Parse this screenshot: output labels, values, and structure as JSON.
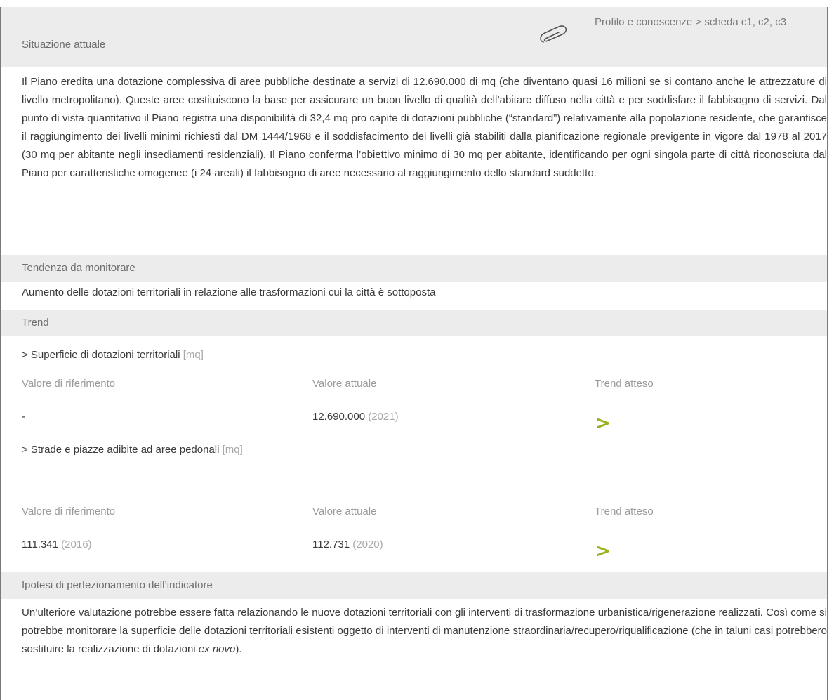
{
  "situazione": {
    "label": "Situazione attuale",
    "reference": "Profilo e conoscenze > scheda  c1, c2, c3",
    "paragraph": "Il Piano eredita una dotazione complessiva di aree pubbliche destinate a servizi di 12.690.000 di mq (che diventano quasi 16 milioni se si contano anche le attrezzature di livello metropolitano). Queste aree  costituiscono la base per assicurare un buon livello di qualità dell’abitare diffuso nella città e per soddisfare il fabbisogno di servizi. Dal punto di vista quantitativo il Piano registra una disponibilità di 32,4 mq pro capite di dotazioni pubbliche (“standard”) relativamente alla popolazione residente, che garantisce il raggiungimento dei livelli minimi richiesti dal DM 1444/1968 e il soddisfacimento dei livelli già stabiliti dalla pianificazione regionale previgente in vigore dal 1978 al 2017 (30 mq per abitante negli insediamenti residenziali). Il Piano conferma l’obiettivo minimo di 30 mq per abitante, identificando per ogni singola parte di città riconosciuta dal Piano per caratteristiche omogenee (i 24 areali) il fabbisogno di aree necessario al raggiungimento dello standard suddetto."
  },
  "tendenza": {
    "label": "Tendenza da monitorare",
    "text": "Aumento delle dotazioni territoriali in relazione alle trasformazioni cui la città è sottoposta"
  },
  "trend": {
    "label": "Trend",
    "indicators": [
      {
        "title": "> Superficie di dotazioni territoriali",
        "unit": "[mq]",
        "ref_label": "Valore di riferimento",
        "cur_label": "Valore attuale",
        "exp_label": "Trend atteso",
        "ref_value": "-",
        "ref_year": "",
        "cur_value": "12.690.000",
        "cur_year": "(2021)",
        "arrow": ">"
      },
      {
        "title": "> Strade e piazze adibite ad aree pedonali",
        "unit": "[mq]",
        "ref_label": "Valore di riferimento",
        "cur_label": "Valore attuale",
        "exp_label": "Trend atteso",
        "ref_value": "111.341",
        "ref_year": "(2016)",
        "cur_value": "112.731",
        "cur_year": "(2020)",
        "arrow": ">"
      }
    ]
  },
  "ipotesi": {
    "label": "Ipotesi di perfezionamento dell’indicatore",
    "paragraph": "Un’ulteriore valutazione potrebbe essere fatta relazionando le nuove  dotazioni territoriali con gli interventi di trasformazione urbanistica/rigenerazione realizzati. Così come si potrebbe monitorare la superficie delle dotazioni territoriali esistenti oggetto di interventi di manutenzione straordinaria/recupero/riqualificazione (che in taluni casi potrebbero sostituire la realizzazione di dotazioni ",
    "italic": "ex novo",
    "tail": ")."
  },
  "colors": {
    "accent": "#9bb01c",
    "band": "#ececec",
    "frame": "#7a7a7a"
  },
  "icons": {
    "attachment": "paperclip-icon",
    "trend": "chevron-right-icon"
  }
}
